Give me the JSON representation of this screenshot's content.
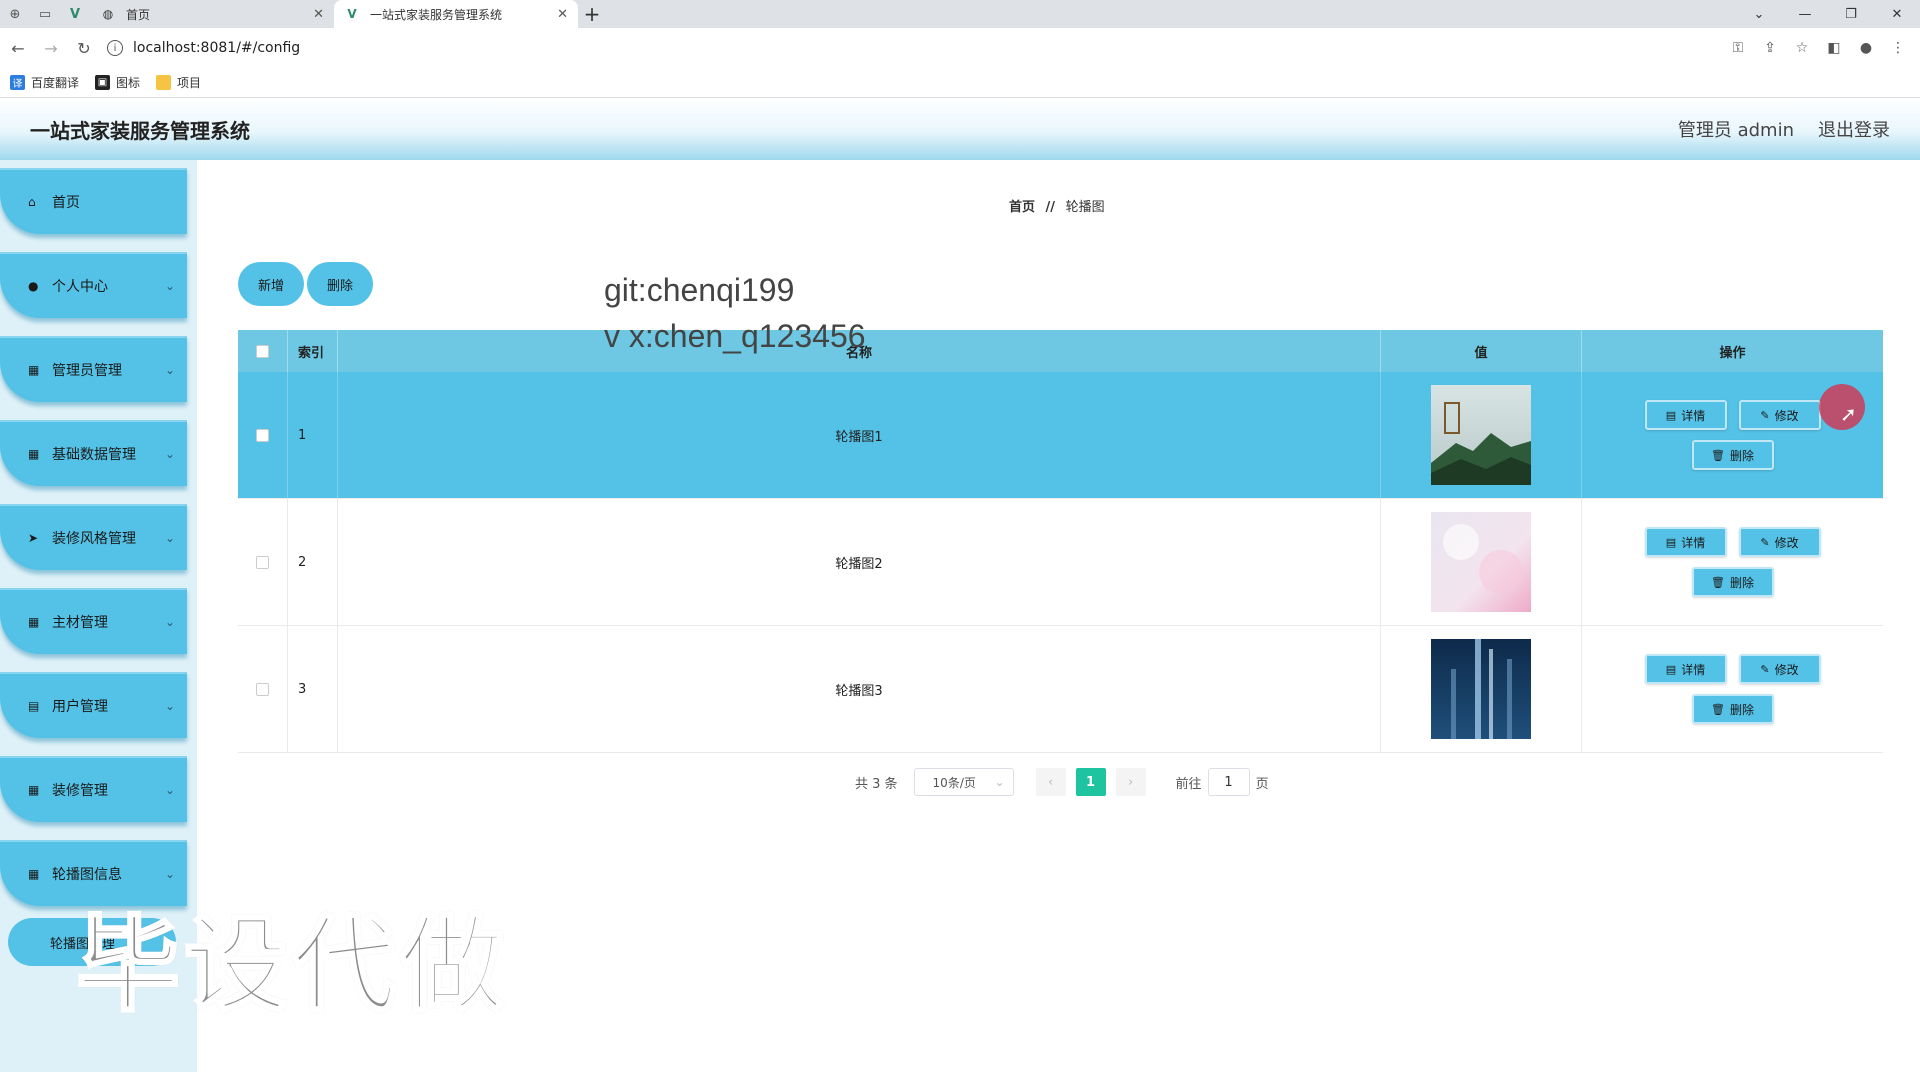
{
  "browser": {
    "tabs": [
      {
        "label": "首页",
        "active": false
      },
      {
        "label": "一站式家装服务管理系统",
        "active": true
      }
    ],
    "url": "localhost:8081/#/config",
    "bookmarks": [
      {
        "label": "百度翻译",
        "color": "#2f7ce0"
      },
      {
        "label": "图标",
        "color": "#222222"
      },
      {
        "label": "项目",
        "color": "#f6c343"
      }
    ]
  },
  "header": {
    "title": "一站式家装服务管理系统",
    "user": "管理员 admin",
    "logout": "退出登录"
  },
  "sidebar": {
    "items": [
      {
        "label": "首页",
        "icon": "home-icon",
        "chevron": false
      },
      {
        "label": "个人中心",
        "icon": "user-icon",
        "chevron": true
      },
      {
        "label": "管理员管理",
        "icon": "grid-icon",
        "chevron": true
      },
      {
        "label": "基础数据管理",
        "icon": "grid-icon",
        "chevron": true
      },
      {
        "label": "装修风格管理",
        "icon": "send-icon",
        "chevron": true
      },
      {
        "label": "主材管理",
        "icon": "grid-icon",
        "chevron": true
      },
      {
        "label": "用户管理",
        "icon": "clipboard-icon",
        "chevron": true
      },
      {
        "label": "装修管理",
        "icon": "grid-icon",
        "chevron": true
      },
      {
        "label": "轮播图信息",
        "icon": "grid-icon",
        "chevron": true
      }
    ],
    "sub_item": "轮播图管理"
  },
  "breadcrumb": {
    "home": "首页",
    "sep": "//",
    "current": "轮播图"
  },
  "toolbar": {
    "add": "新增",
    "delete": "删除"
  },
  "watermark": {
    "line1": "git:chenqi199",
    "line2": "v x:chen_q123456",
    "big": "毕设代做"
  },
  "table": {
    "columns": [
      "索引",
      "名称",
      "值",
      "操作"
    ],
    "rows": [
      {
        "index": "1",
        "name": "轮播图1",
        "highlight": true
      },
      {
        "index": "2",
        "name": "轮播图2",
        "highlight": false
      },
      {
        "index": "3",
        "name": "轮播图3",
        "highlight": false
      }
    ],
    "actions": {
      "detail": "详情",
      "edit": "修改",
      "delete": "删除"
    }
  },
  "pagination": {
    "total": "共 3 条",
    "page_size": "10条/页",
    "current": "1",
    "goto_label": "前往",
    "goto_value": "1",
    "page_suffix": "页"
  },
  "colors": {
    "accent": "#54c1e6",
    "header_row": "#6ec8e3",
    "page_active": "#1ec3a0",
    "sidebar_bg": "#dff1f8"
  }
}
